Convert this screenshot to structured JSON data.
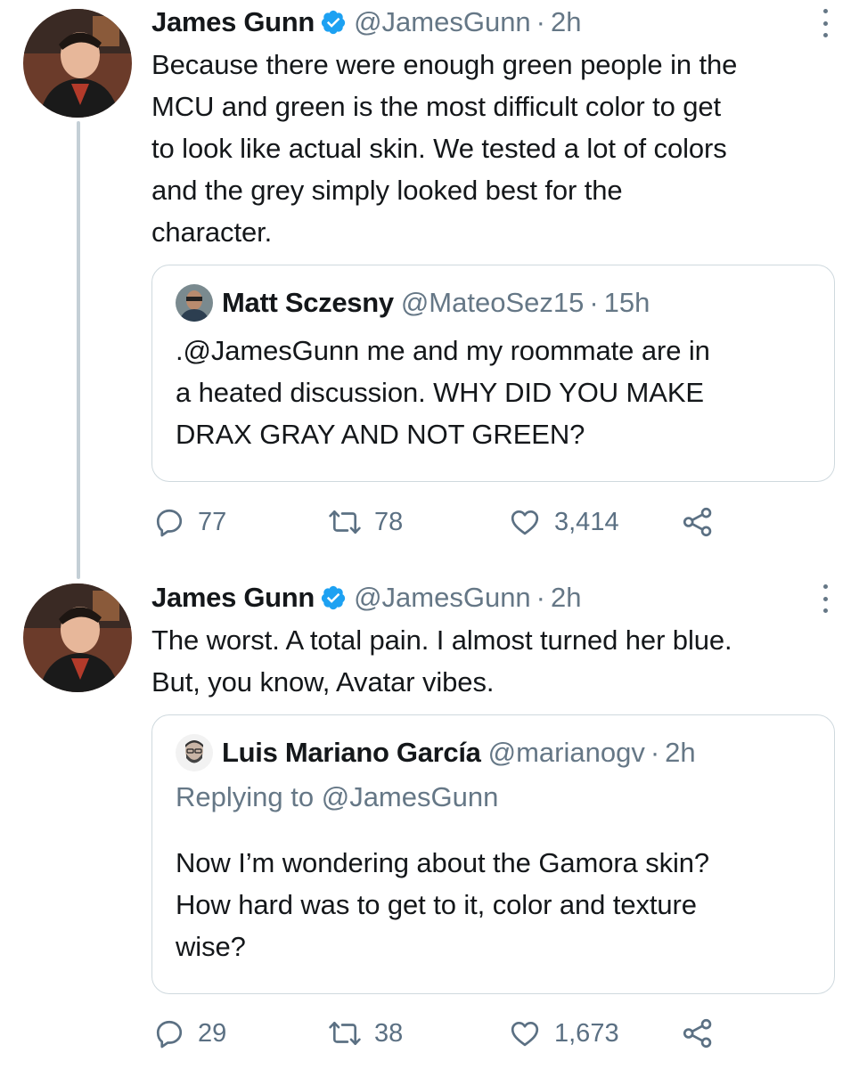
{
  "tweets": [
    {
      "author": {
        "name": "James Gunn",
        "handle": "@JamesGunn",
        "time": "2h",
        "verified": true
      },
      "text": "Because there were enough green people in the MCU and green is the most difficult color to get to look like actual skin. We tested a lot of colors and the grey simply looked best for the character.",
      "text_lines": [
        "Because there were enough green people in the",
        "MCU and green is the most difficult color to get",
        "to look like actual skin. We tested a lot of colors",
        "and the grey simply looked best for the",
        "character."
      ],
      "quote": {
        "name": "Matt Sczesny",
        "handle": "@MateoSez15",
        "time": "15h",
        "text_lines": [
          ".@JamesGunn me and my roommate are in",
          "a heated discussion. WHY DID YOU MAKE",
          "DRAX GRAY AND NOT GREEN?"
        ]
      },
      "actions": {
        "replies": "77",
        "retweets": "78",
        "likes": "3,414"
      }
    },
    {
      "author": {
        "name": "James Gunn",
        "handle": "@JamesGunn",
        "time": "2h",
        "verified": true
      },
      "text_lines": [
        "The worst. A total pain. I almost turned her blue.",
        "But, you know, Avatar vibes."
      ],
      "quote": {
        "name": "Luis Mariano García",
        "handle": "@marianogv",
        "time": "2h",
        "replying_prefix": "Replying to",
        "replying_to": "@JamesGunn",
        "text_lines": [
          "Now I’m wondering about the Gamora skin?",
          "How hard was to get to it, color and texture",
          "wise?"
        ]
      },
      "actions": {
        "replies": "29",
        "retweets": "38",
        "likes": "1,673"
      }
    }
  ],
  "separator": "·",
  "colors": {
    "verified": "#1da1f2",
    "secondary_text": "#657786",
    "border": "#cfd9de",
    "thread_line": "#c4cfd6"
  },
  "icons": [
    "verified-badge-icon",
    "more-options-icon",
    "reply-icon",
    "retweet-icon",
    "like-icon",
    "share-icon"
  ]
}
